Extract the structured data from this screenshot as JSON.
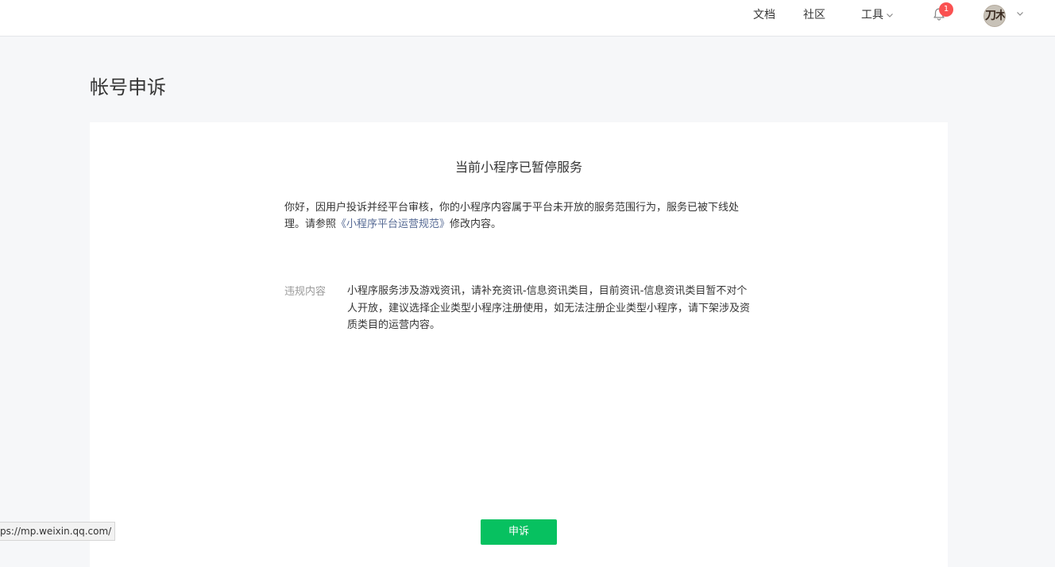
{
  "topbar": {
    "docs_label": "文档",
    "community_label": "社区",
    "tools_label": "工具",
    "notification_count": "1",
    "avatar_text": "刀木",
    "icons": {
      "tools_dropdown": "chevron-down-icon",
      "notifications": "bell-icon",
      "account_dropdown": "chevron-down-icon"
    }
  },
  "page": {
    "title": "帐号申诉"
  },
  "notice": {
    "heading": "当前小程序已暂停服务",
    "body_before": "你好，因用户投诉并经平台审核，你的小程序内容属于平台未开放的服务范围行为，服务已被下线处理。请参照",
    "policy_link": "《小程序平台运营规范》",
    "body_after": "修改内容。",
    "violation_label": "违规内容",
    "violation_content": "小程序服务涉及游戏资讯，请补充资讯-信息资讯类目，目前资讯-信息资讯类目暂不对个人开放，建议选择企业类型小程序注册使用，如无法注册企业类型小程序，请下架涉及资质类目的运营内容。",
    "appeal_button": "申诉"
  },
  "status_bar": {
    "url": "ps://mp.weixin.qq.com/"
  },
  "colors": {
    "accent_green": "#07c160",
    "link_blue": "#576b95",
    "badge_red": "#fa5151",
    "page_background": "#f6f7f9"
  }
}
